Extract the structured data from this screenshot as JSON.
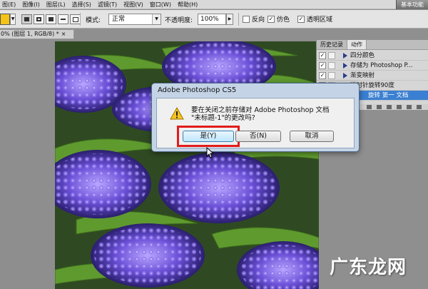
{
  "menubar": {
    "items": [
      "图(E)",
      "图像(I)",
      "图层(L)",
      "选择(S)",
      "滤镜(T)",
      "视图(V)",
      "窗口(W)",
      "帮助(H)"
    ],
    "workspace_label": "基本功能"
  },
  "options_bar": {
    "mode_label": "模式:",
    "mode_value": "正常",
    "opacity_label": "不透明度:",
    "opacity_value": "100%",
    "reverse_label": "反向",
    "dither_label": "仿色",
    "transparency_label": "透明区域",
    "reverse_checked": false,
    "dither_checked": true,
    "transparency_checked": true,
    "swatch_color": "#f3c417"
  },
  "document_tab": {
    "title": "0% (图层 1, RGB/8) *",
    "close": "×"
  },
  "panel": {
    "tabs": [
      "历史记录",
      "动作"
    ],
    "active_tab": 1,
    "rows": [
      {
        "text": "四分颜色",
        "checked": true,
        "dialog": false
      },
      {
        "text": "存储为 Photoshop P...",
        "checked": true,
        "dialog": true
      },
      {
        "text": "渐变映射",
        "checked": true,
        "dialog": false
      },
      {
        "text": "逆时针旋转90度",
        "checked": true,
        "dialog": false
      },
      {
        "text": "旋转 第一 文档",
        "checked": true,
        "dialog": false
      }
    ]
  },
  "dialog": {
    "title": "Adobe Photoshop CS5",
    "message_line1": "要在关闭之前存储对 Adobe Photoshop 文档",
    "message_line2": "\"未标题-1\"的更改吗?",
    "yes_label": "是(Y)",
    "no_label": "否(N)",
    "cancel_label": "取消",
    "highlight_color": "#e21b1b"
  },
  "watermark": {
    "text": "广东龙网"
  }
}
